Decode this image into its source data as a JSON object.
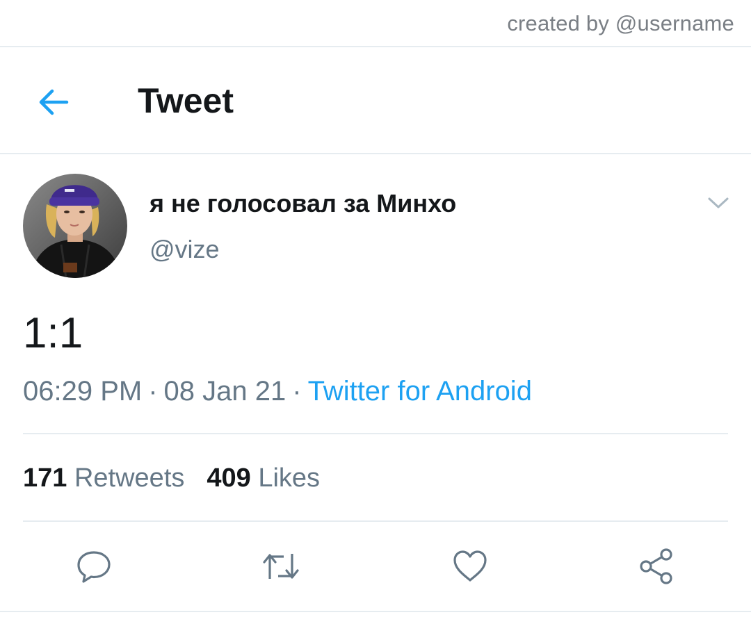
{
  "watermark": {
    "text": "created by @username"
  },
  "header": {
    "title": "Tweet",
    "back_icon": "arrow-left-icon"
  },
  "tweet": {
    "author": {
      "display_name": "я не голосовал за Минхо",
      "handle": "@vize"
    },
    "text": "1:1",
    "time": "06:29 PM",
    "date": "08 Jan 21",
    "separator": "·",
    "source": "Twitter for Android",
    "stats": {
      "retweets_count": "171",
      "retweets_label": "Retweets",
      "likes_count": "409",
      "likes_label": "Likes"
    },
    "actions": [
      "reply-icon",
      "retweet-icon",
      "like-icon",
      "share-icon"
    ]
  },
  "colors": {
    "accent": "#1da1f2",
    "text_primary": "#14171a",
    "text_secondary": "#657786",
    "divider": "#e6ecf0"
  }
}
